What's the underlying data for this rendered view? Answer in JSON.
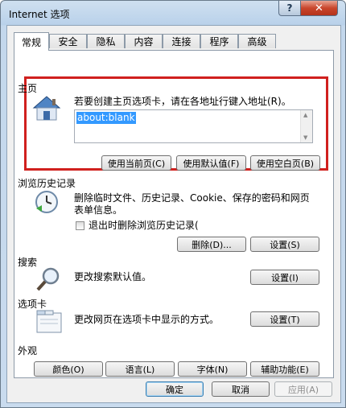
{
  "window": {
    "title": "Internet 选项",
    "help_glyph": "?",
    "close_glyph": "✕"
  },
  "tabs": [
    "常规",
    "安全",
    "隐私",
    "内容",
    "连接",
    "程序",
    "高级"
  ],
  "home": {
    "label": "主页",
    "desc": "若要创建主页选项卡，请在各地址行键入地址(R)。",
    "address": "about:blank",
    "btn_current": "使用当前页(C)",
    "btn_default": "使用默认值(F)",
    "btn_blank": "使用空白页(B)"
  },
  "history": {
    "label": "浏览历史记录",
    "desc1": "删除临时文件、历史记录、Cookie、保存的密码和网页",
    "desc2": "表单信息。",
    "checkbox_label": "退出时删除浏览历史记录(",
    "btn_delete": "删除(D)...",
    "btn_settings": "设置(S)"
  },
  "search": {
    "label": "搜索",
    "desc": "更改搜索默认值。",
    "btn_settings": "设置(I)"
  },
  "tabs_group": {
    "label": "选项卡",
    "desc": "更改网页在选项卡中显示的方式。",
    "btn_settings": "设置(T)"
  },
  "appearance": {
    "label": "外观",
    "btn_colors": "颜色(O)",
    "btn_languages": "语言(L)",
    "btn_fonts": "字体(N)",
    "btn_accessibility": "辅助功能(E)"
  },
  "footer": {
    "ok": "确定",
    "cancel": "取消",
    "apply": "应用(A)"
  },
  "colors": {
    "accent": "#3399ff",
    "highlight_box": "#d0201e",
    "close": "#c9462c"
  }
}
